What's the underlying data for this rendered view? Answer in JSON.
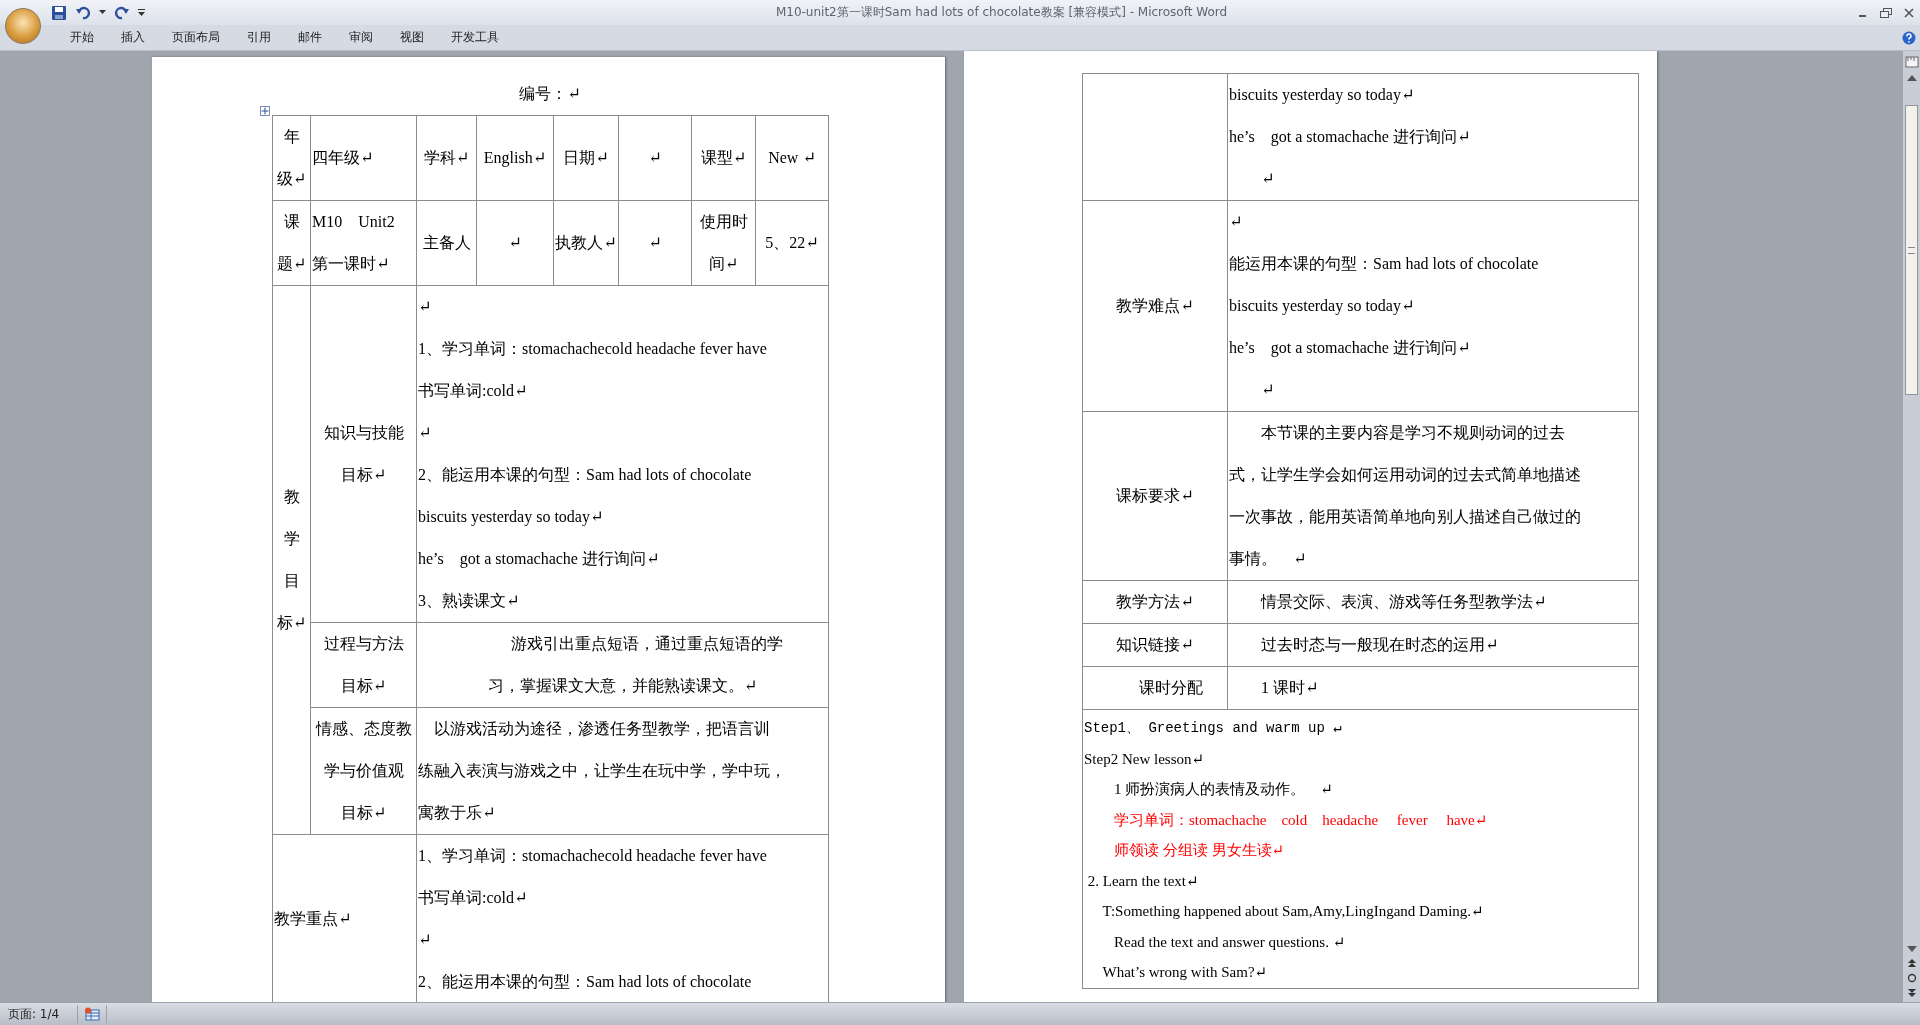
{
  "window": {
    "title": "M10-unit2第一课时Sam had lots of chocolate教案 [兼容模式] - Microsoft Word"
  },
  "ribbon_tabs": [
    {
      "label": "开始",
      "selected": false
    },
    {
      "label": "插入",
      "selected": false
    },
    {
      "label": "页面布局",
      "selected": false
    },
    {
      "label": "引用",
      "selected": false
    },
    {
      "label": "邮件",
      "selected": false
    },
    {
      "label": "审阅",
      "selected": false
    },
    {
      "label": "视图",
      "selected": false
    },
    {
      "label": "开发工具",
      "selected": false
    }
  ],
  "document": {
    "left_page": {
      "heading": "编号：↵",
      "rows": [
        {
          "cells": [
            {
              "lines": [
                "年",
                "级↵"
              ]
            },
            {
              "lines": [
                "四年级↵"
              ],
              "kind": "body"
            },
            {
              "lines": [
                "学科↵"
              ]
            },
            {
              "lines": [
                "English↵"
              ]
            },
            {
              "lines": [
                "日期↵"
              ]
            },
            {
              "lines": [
                "↵"
              ]
            },
            {
              "lines": [
                "课型↵"
              ]
            },
            {
              "lines": [
                "New ↵"
              ]
            }
          ]
        },
        {
          "cells": [
            {
              "lines": [
                "课",
                "题↵"
              ]
            },
            {
              "lines": [
                "M10　Unit2",
                "第一课时↵"
              ],
              "kind": "body"
            },
            {
              "lines": [
                "主备人"
              ]
            },
            {
              "lines": [
                "↵"
              ]
            },
            {
              "lines": [
                "执教人↵"
              ]
            },
            {
              "lines": [
                "↵"
              ]
            },
            {
              "lines": [
                "使用时",
                "间↵"
              ]
            },
            {
              "lines": [
                "5、22↵"
              ]
            }
          ]
        },
        {
          "cells": [
            {
              "lines": [
                "教",
                "学",
                "目",
                "标↵"
              ],
              "rowspan": 3
            },
            {
              "lines": [
                "知识与技能",
                "目标↵"
              ]
            },
            {
              "lines": [
                "↵",
                "1、学习单词：stomachachecold headache fever have",
                "书写单词:cold↵",
                "↵",
                "2、能运用本课的句型：Sam had lots of chocolate",
                "biscuits yesterday so today↵",
                "he’s　got a stomachache 进行询问↵",
                "3、熟读课文↵"
              ],
              "colspan": 6,
              "kind": "body"
            }
          ]
        },
        {
          "cells": [
            {
              "lines": [
                "过程与方法",
                "目标↵"
              ]
            },
            {
              "lines": [
                "　　　游戏引出重点短语，通过重点短语的学",
                "习，掌握课文大意，并能熟读课文。↵"
              ],
              "colspan": 6
            }
          ]
        },
        {
          "cells": [
            {
              "lines": [
                "情感、态度教",
                "学与价值观",
                "目标↵"
              ]
            },
            {
              "lines": [
                "　以游戏活动为途径，渗透任务型教学，把语言训",
                "练融入表演与游戏之中，让学生在玩中学，学中玩，",
                "寓教于乐↵"
              ],
              "colspan": 6,
              "kind": "body"
            }
          ]
        },
        {
          "cells": [
            {
              "lines": [
                "教学重点↵"
              ],
              "colspan": 2,
              "kind": "body"
            },
            {
              "lines": [
                "1、学习单词：stomachachecold headache fever have",
                "书写单词:cold↵",
                "↵",
                "2、能运用本课的句型：Sam had lots of chocolate"
              ],
              "colspan": 6,
              "kind": "body"
            }
          ]
        }
      ]
    },
    "right_page": {
      "rows": [
        {
          "cells": [
            {},
            {
              "lines": [
                "biscuits yesterday so today↵",
                "he’s　got a stomachache 进行询问↵",
                "　　↵"
              ],
              "kind": "body"
            }
          ]
        },
        {
          "cells": [
            {
              "lines": [
                "教学难点↵"
              ]
            },
            {
              "lines": [
                "↵",
                "能运用本课的句型：Sam had lots of chocolate",
                "biscuits yesterday so today↵",
                "he’s　got a stomachache 进行询问↵",
                "　　↵"
              ],
              "kind": "body"
            }
          ]
        },
        {
          "cells": [
            {
              "lines": [
                "课标要求↵"
              ]
            },
            {
              "lines": [
                "　　本节课的主要内容是学习不规则动词的过去",
                "式，让学生学会如何运用动词的过去式简单地描述",
                "一次事故，能用英语简单地向别人描述自己做过的",
                "事情。　↵"
              ],
              "kind": "body"
            }
          ]
        },
        {
          "cells": [
            {
              "lines": [
                "教学方法↵"
              ]
            },
            {
              "lines": [
                "　　情景交际、表演、游戏等任务型教学法↵"
              ],
              "kind": "body"
            }
          ]
        },
        {
          "cells": [
            {
              "lines": [
                "知识链接↵"
              ]
            },
            {
              "lines": [
                "　　过去时态与一般现在时态的运用↵"
              ],
              "kind": "body"
            }
          ]
        },
        {
          "cells": [
            {
              "lines": [
                "　　课时分配"
              ]
            },
            {
              "lines": [
                "　　1 课时↵"
              ],
              "kind": "body"
            }
          ]
        },
        {
          "cells": [
            {
              "colspan": 2,
              "kind": "steps",
              "lines": [
                {
                  "text": "Step1、 Greetings and warm up ↵",
                  "color": "#000000"
                },
                {
                  "text": "Step2 New lesson↵",
                  "color": "#000000"
                },
                {
                  "text": "　　1 师扮演病人的表情及动作。　↵",
                  "color": "#000000"
                },
                {
                  "text": "　　学习单词：stomachache　cold　headache　 fever　 have↵",
                  "color": "#ff0000"
                },
                {
                  "text": "　　师领读 分组读 男女生读↵",
                  "color": "#ff0000"
                },
                {
                  "text": " 2. Learn the text↵",
                  "color": "#000000"
                },
                {
                  "text": "　 T:Something happened about Sam,Amy,LingIngand Daming.↵",
                  "color": "#000000"
                },
                {
                  "text": "　　Read the text and answer questions. ↵",
                  "color": "#000000"
                },
                {
                  "text": "　 What’s wrong with Sam?↵",
                  "color": "#000000"
                }
              ]
            }
          ]
        }
      ]
    }
  },
  "status_bar": {
    "page": "页面: 1/4"
  }
}
